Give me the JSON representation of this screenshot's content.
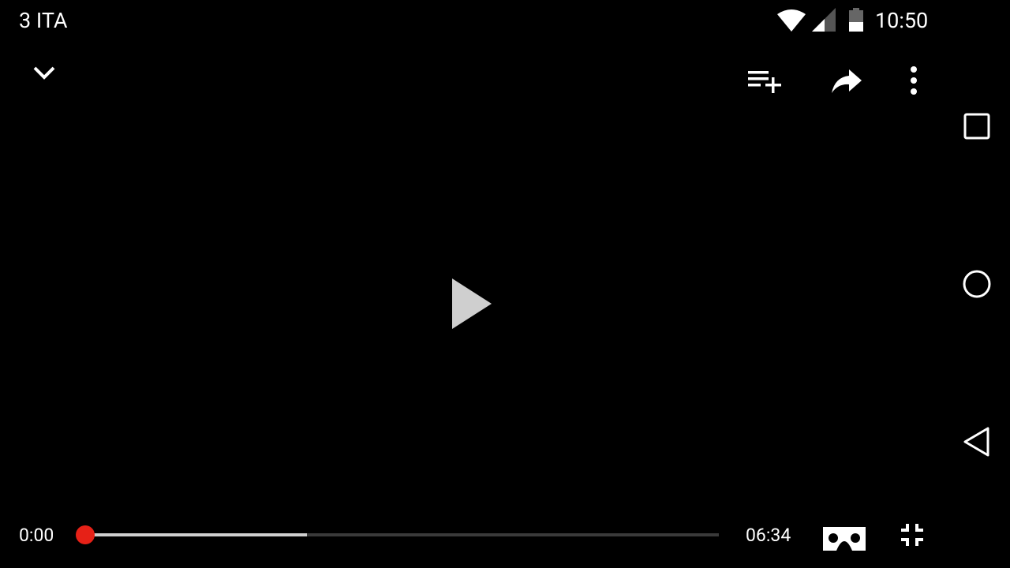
{
  "status_bar": {
    "carrier": "3 ITA",
    "time": "10:50",
    "icons": [
      "wifi-icon",
      "cell-signal-icon",
      "battery-icon"
    ]
  },
  "player": {
    "top_controls": [
      "chevron-down-icon",
      "add-to-playlist-icon",
      "share-icon",
      "more-options-icon"
    ],
    "center_control": "play-icon",
    "current_time": "0:00",
    "total_time": "06:34",
    "progress": 0.0,
    "buffered": 0.35,
    "bottom_controls": [
      "cardboard-vr-icon",
      "fullscreen-exit-icon"
    ]
  },
  "nav_bar": {
    "icons": [
      "recents-icon",
      "home-icon",
      "back-icon"
    ]
  },
  "colors": {
    "background": "#000000",
    "seek_thumb": "#e62117",
    "seek_buffer": "#cfcfcf",
    "seek_track": "#3a3a3a",
    "icon": "#ffffff"
  }
}
